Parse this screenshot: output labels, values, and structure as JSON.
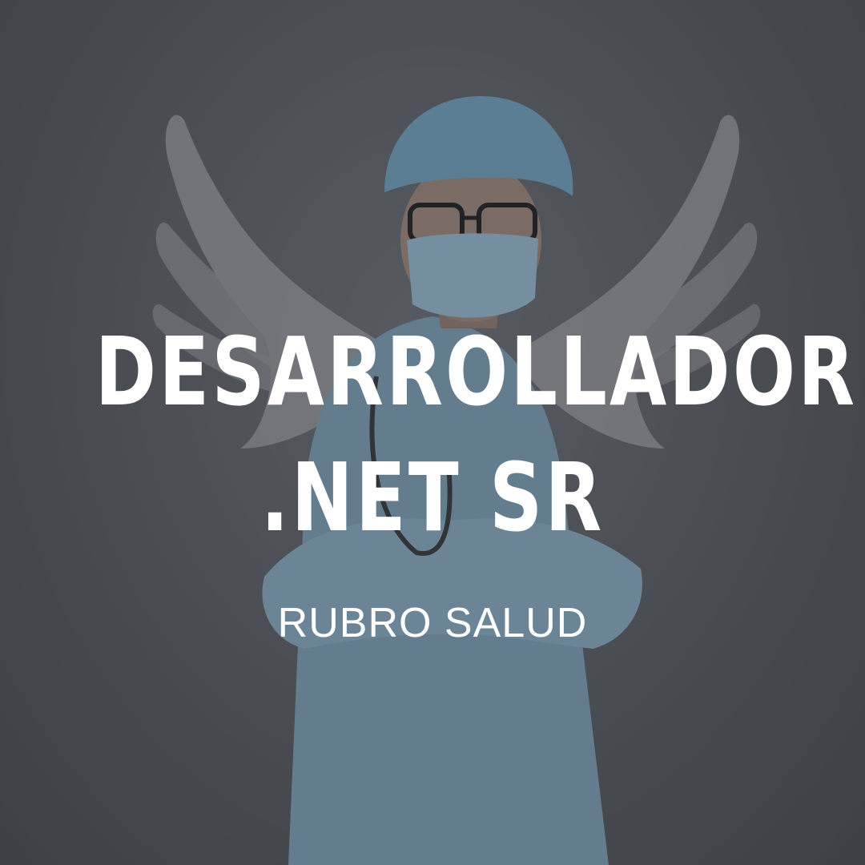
{
  "poster": {
    "headline_line1": "DESARROLLADOR",
    "headline_line2": ".NET SR",
    "subtitle": "RUBRO SALUD"
  },
  "colors": {
    "background": "#5a5d62",
    "text": "#ffffff",
    "scrubs": "#8aaec4",
    "wings": "#a9abae"
  }
}
